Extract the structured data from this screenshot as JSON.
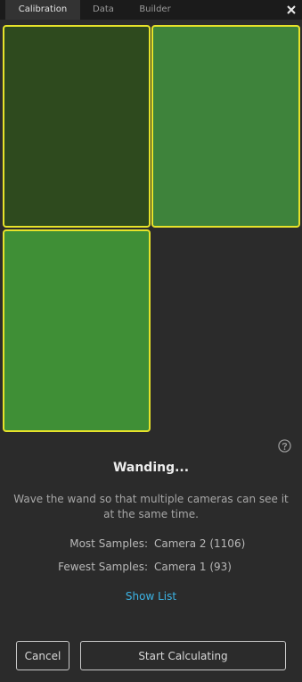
{
  "tabs": [
    {
      "label": "Calibration",
      "active": true
    },
    {
      "label": "Data",
      "active": false
    },
    {
      "label": "Builder",
      "active": false
    }
  ],
  "window": {
    "close_icon": "close-icon"
  },
  "cameras": [
    {
      "id": "camera-1",
      "color": "#2e4a1e",
      "border": "#e6e22a"
    },
    {
      "id": "camera-2",
      "color": "#3e833b",
      "border": "#e6e22a"
    },
    {
      "id": "camera-3",
      "color": "#3f8f36",
      "border": "#e6e22a"
    }
  ],
  "help": {
    "icon": "help-icon"
  },
  "status": {
    "title": "Wanding...",
    "instructions": "Wave the wand so that multiple cameras can see it at the same time."
  },
  "stats": {
    "most_label": "Most Samples:",
    "most_value": "Camera 2 (1106)",
    "fewest_label": "Fewest Samples:",
    "fewest_value": "Camera 1 (93)"
  },
  "links": {
    "show_list": "Show List"
  },
  "buttons": {
    "cancel": "Cancel",
    "start": "Start Calculating"
  },
  "colors": {
    "accent_link": "#3cb4e5",
    "tile_border": "#e6e22a",
    "background": "#2b2b2b"
  }
}
